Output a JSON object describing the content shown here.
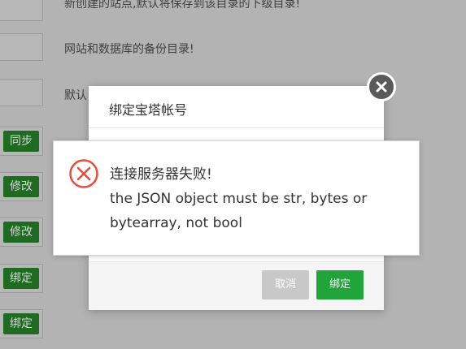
{
  "background": {
    "descriptions": [
      "新创建的站点,默认将保存到该目录的下级目录!",
      "网站和数据库的备份目录!",
      "默认"
    ],
    "buttons": [
      "同步",
      "修改",
      "修改",
      "绑定",
      "绑定"
    ]
  },
  "modal": {
    "title": "绑定宝塔帐号",
    "cancel_label": "取消",
    "bind_label": "绑定"
  },
  "error": {
    "line1": "连接服务器失败!",
    "line2": "the JSON object must be str, bytes or bytearray, not bool"
  },
  "colors": {
    "accent": "#20a53a",
    "error": "#e84c3d"
  },
  "icons": {
    "close": "close-icon",
    "error": "error-x-icon"
  }
}
